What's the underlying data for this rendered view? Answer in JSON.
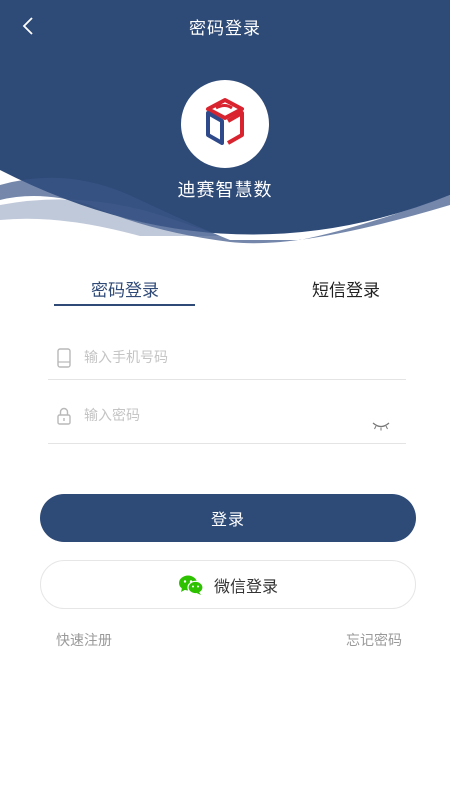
{
  "header": {
    "title": "密码登录",
    "app_name": "迪赛智慧数",
    "colors": {
      "primary": "#2e4a77",
      "wave": "#3b5688"
    }
  },
  "tabs": [
    {
      "label": "密码登录",
      "active": true
    },
    {
      "label": "短信登录",
      "active": false
    }
  ],
  "form": {
    "phone": {
      "placeholder": "输入手机号码",
      "value": "",
      "icon": "phone-icon"
    },
    "password": {
      "placeholder": "输入密码",
      "value": "",
      "icon": "lock-icon",
      "toggle_icon": "eye-closed-icon"
    }
  },
  "buttons": {
    "login_label": "登录",
    "wechat_label": "微信登录"
  },
  "links": {
    "register": "快速注册",
    "forgot": "忘记密码"
  },
  "colors": {
    "accent": "#2e4a77",
    "wechat": "#2dc100",
    "logo_red": "#d9232e",
    "logo_blue": "#2f4a8a"
  }
}
